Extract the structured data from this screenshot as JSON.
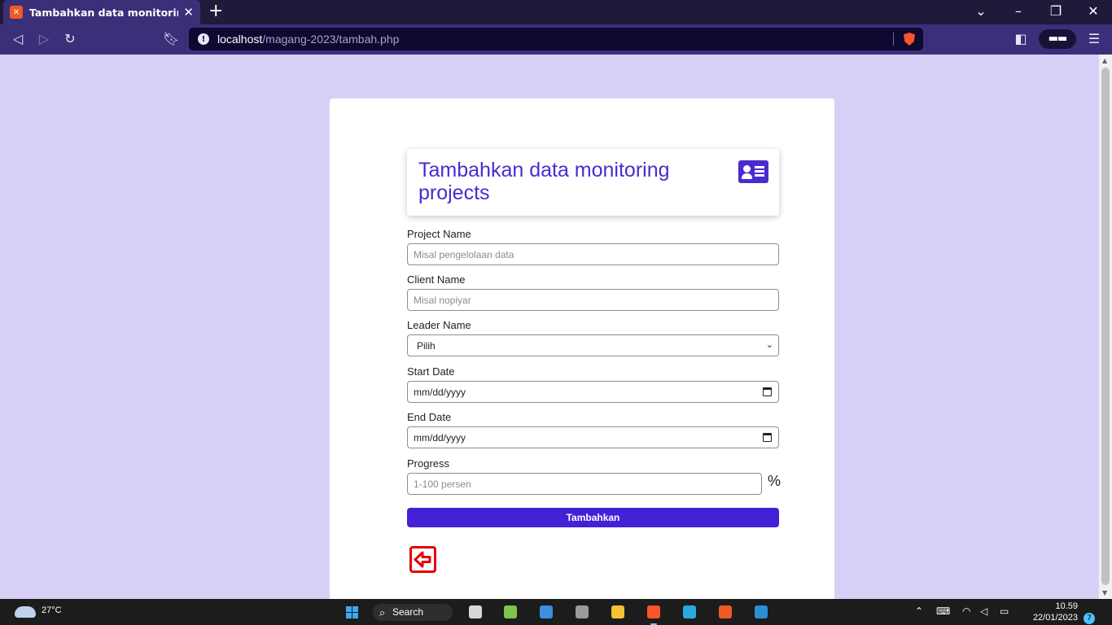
{
  "browser": {
    "tab_title": "Tambahkan data monitoring projects",
    "tab_icon": "xampp-icon",
    "url_host": "localhost",
    "url_path": "/magang-2023/tambah.php"
  },
  "form": {
    "title": "Tambahkan data monitoring projects",
    "fields": {
      "project_name": {
        "label": "Project Name",
        "placeholder": "Misal pengelolaan data"
      },
      "client_name": {
        "label": "Client Name",
        "placeholder": "Misal nopiyar"
      },
      "leader_name": {
        "label": "Leader Name",
        "value": "Pilih"
      },
      "start_date": {
        "label": "Start Date",
        "value": "mm/dd/yyyy"
      },
      "end_date": {
        "label": "End Date",
        "value": "mm/dd/yyyy"
      },
      "progress": {
        "label": "Progress",
        "placeholder": "1-100 persen",
        "unit": "%"
      }
    },
    "submit_label": "Tambahkan",
    "accent_color": "#4420d6",
    "back_icon_color": "#e40000"
  },
  "taskbar": {
    "weather": "27°C",
    "search_label": "Search",
    "time": "10.59",
    "date": "22/01/2023",
    "notification_count": "7"
  }
}
